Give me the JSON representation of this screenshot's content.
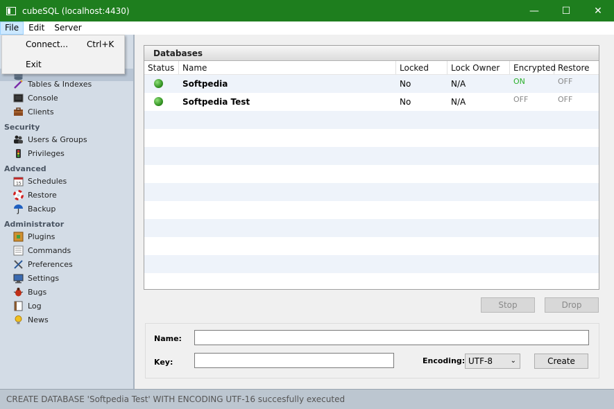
{
  "window": {
    "title": "cubeSQL (localhost:4430)",
    "minimize": "—",
    "maximize": "☐",
    "close": "✕"
  },
  "menu": [
    "File",
    "Edit",
    "Server"
  ],
  "file_menu": [
    {
      "label": "Connect...",
      "shortcut": "Ctrl+K"
    },
    {
      "label": "Exit",
      "shortcut": ""
    }
  ],
  "sidebar": {
    "items_top": [
      "Tables & Indexes",
      "Console",
      "Clients"
    ],
    "security": {
      "title": "Security",
      "items": [
        "Users & Groups",
        "Privileges"
      ]
    },
    "advanced": {
      "title": "Advanced",
      "items": [
        "Schedules",
        "Restore",
        "Backup"
      ]
    },
    "administrator": {
      "title": "Administrator",
      "items": [
        "Plugins",
        "Commands",
        "Preferences",
        "Settings",
        "Bugs",
        "Log",
        "News"
      ]
    }
  },
  "databases": {
    "title": "Databases",
    "columns": [
      "Status",
      "Name",
      "Locked",
      "Lock Owner",
      "Encrypted",
      "Restore"
    ],
    "rows": [
      {
        "name": "Softpedia",
        "locked": "No",
        "lock_owner": "N/A",
        "encrypted": "ON",
        "restore": "OFF"
      },
      {
        "name": "Softpedia Test",
        "locked": "No",
        "lock_owner": "N/A",
        "encrypted": "OFF",
        "restore": "OFF"
      }
    ]
  },
  "buttons": {
    "stop": "Stop",
    "drop": "Drop",
    "create": "Create"
  },
  "form": {
    "name_label": "Name:",
    "key_label": "Key:",
    "encoding_label": "Encoding:",
    "encoding_value": "UTF-8"
  },
  "status": "CREATE DATABASE 'Softpedia Test' WITH ENCODING UTF-16 succesfully executed",
  "colors": {
    "titlebar": "#1e7e1e",
    "sidebar": "#d3dce6",
    "on": "#2ab02a"
  }
}
